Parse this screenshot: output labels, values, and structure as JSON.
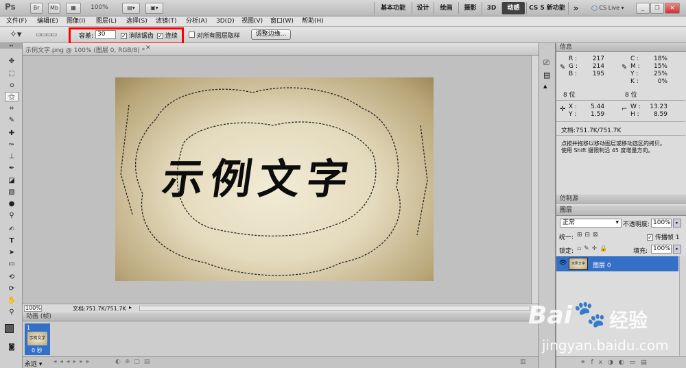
{
  "appbar": {
    "logo": "Ps",
    "br": "Br",
    "mb": "Mb",
    "zoom": "100%",
    "workspaces": [
      "基本功能",
      "设计",
      "绘画",
      "摄影",
      "3D",
      "动感"
    ],
    "active_workspace": "动感",
    "cs5_new": "CS 5 新功能",
    "more": "»",
    "cslive": "CS Live"
  },
  "menu": [
    "文件(F)",
    "编辑(E)",
    "图像(I)",
    "图层(L)",
    "选择(S)",
    "滤镜(T)",
    "分析(A)",
    "3D(D)",
    "视图(V)",
    "窗口(W)",
    "帮助(H)"
  ],
  "options": {
    "tolerance_label": "容差:",
    "tolerance_value": "30",
    "antialias_label": "消除锯齿",
    "contiguous_label": "连续",
    "sample_all_label": "对所有图层取样",
    "refine_edge_label": "调整边缘..."
  },
  "document": {
    "tab_title": "示例文字.png @ 100% (图层 0, RGB/8) *",
    "image_text": "示例文字",
    "zoom": "100%",
    "status": "文档:751.7K/751.7K"
  },
  "animation": {
    "title": "动画 (帧)",
    "frame_number": "1",
    "frame_delay": "0 秒",
    "loop": "永远"
  },
  "info": {
    "title": "信息",
    "r_label": "R :",
    "r": "217",
    "g_label": "G :",
    "g": "214",
    "b_label": "B :",
    "b": "195",
    "c_label": "C :",
    "c": "18%",
    "m_label": "M :",
    "m": "15%",
    "y_label": "Y :",
    "y": "25%",
    "k_label": "K :",
    "k": "0%",
    "bit1": "8 位",
    "bit2": "8 位",
    "x_label": "X :",
    "x": "5.44",
    "yy_label": "Y :",
    "yy": "1.59",
    "w_label": "W :",
    "w": "13.23",
    "h_label": "H :",
    "h": "8.59",
    "doc": "文档:751.7K/751.7K",
    "hint1": "点按并拖移以移动图层或移动选区的拷贝。",
    "hint2": "使用 Shift 键限制沿 45 度增量方向。"
  },
  "clone_source": {
    "title": "仿制源"
  },
  "layers": {
    "title": "图层",
    "blend_mode": "正常",
    "opacity_label": "不透明度:",
    "opacity": "100%",
    "unify_label": "统一:",
    "propagate_label": "传播帧 1",
    "lock_label": "锁定:",
    "fill_label": "填充:",
    "fill": "100%",
    "layer_name": "图层 0",
    "thumb_text": "示例文字"
  },
  "watermark": {
    "brand": "Bai",
    "brand_cn": "经验",
    "url": "jingyan.baidu.com"
  },
  "colors": {
    "highlight_red": "#ff0000",
    "layer_selected": "#3470c8",
    "active_workspace_bg": "#404040"
  }
}
